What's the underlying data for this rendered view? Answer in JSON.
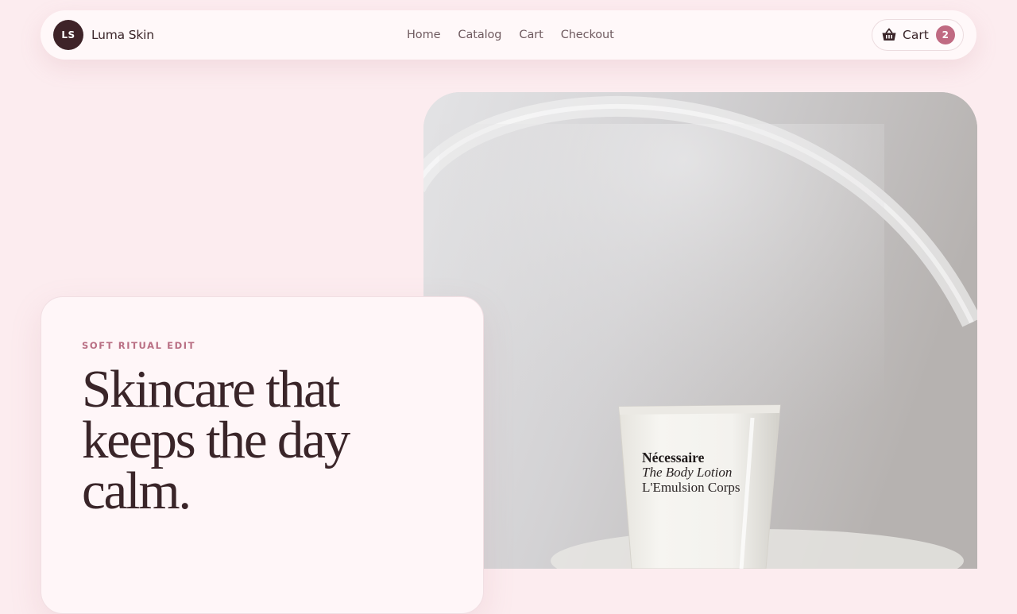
{
  "brand": {
    "initials": "LS",
    "name": "Luma Skin"
  },
  "nav": {
    "links": [
      "Home",
      "Catalog",
      "Cart",
      "Checkout"
    ]
  },
  "cart": {
    "label": "Cart",
    "count": "2",
    "icon": "basket-icon"
  },
  "hero": {
    "eyebrow": "SOFT RITUAL EDIT",
    "headline": "Skincare that keeps the day calm.",
    "product_label": {
      "brand": "Nécessaire",
      "line1": "The Body Lotion",
      "line2": "L'Emulsion Corps"
    }
  },
  "colors": {
    "background": "#fcecef",
    "surface": "#fff8f9",
    "ink": "#3a2529",
    "accent": "#c06a82",
    "badge": "#3e2328"
  }
}
